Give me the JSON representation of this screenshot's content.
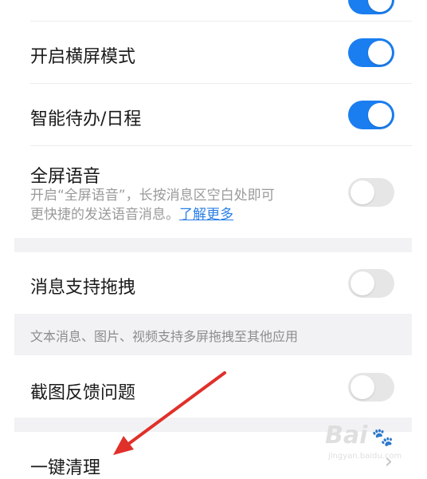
{
  "settings": {
    "landscape": {
      "label": "开启横屏模式",
      "state": "on"
    },
    "smart_todo": {
      "label": "智能待办/日程",
      "state": "on"
    },
    "fullscreen_voice": {
      "label": "全屏语音",
      "desc_line1": "开启“全屏语音”，长按消息区空白处即可",
      "desc_line2": "更快捷的发送语音消息。",
      "link": "了解更多",
      "state": "off"
    },
    "drag_messages": {
      "label": "消息支持拖拽",
      "state": "off"
    },
    "drag_desc": "文本消息、图片、视频支持多屏拖拽至其他应用",
    "screenshot_feedback": {
      "label": "截图反馈问题",
      "state": "off"
    },
    "one_click_clean": {
      "label": "一键清理"
    }
  },
  "colors": {
    "toggle_on": "#1a7ef0",
    "toggle_off": "#e6e6e6",
    "link": "#2a7ee6",
    "arrow": "#e0302a"
  },
  "watermark": {
    "brand": "Bai",
    "sub": "jingyan.baidu.com"
  }
}
